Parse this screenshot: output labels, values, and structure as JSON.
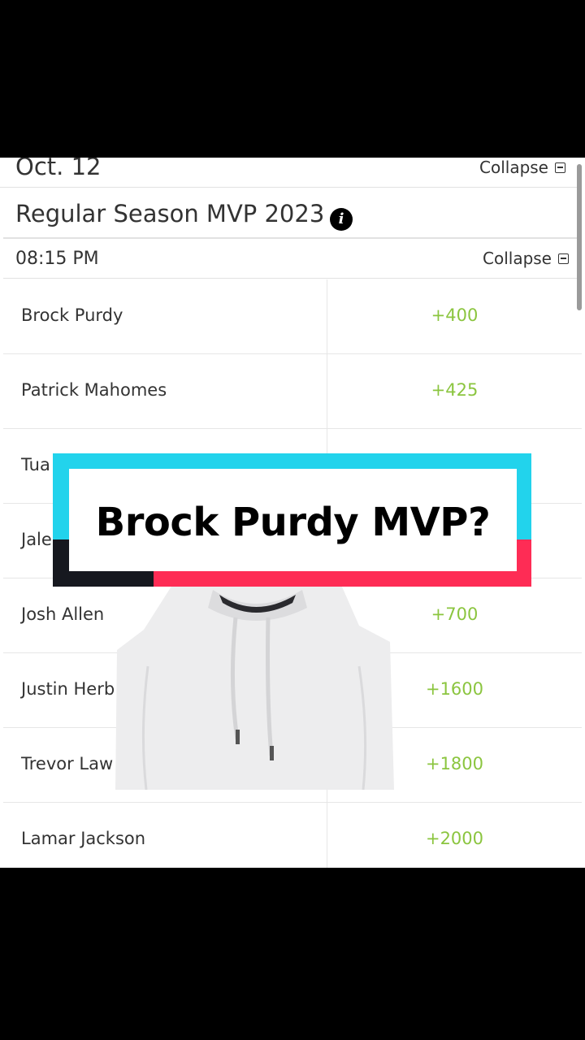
{
  "header": {
    "date": "Oct. 12",
    "collapse_label": "Collapse"
  },
  "market": {
    "title": "Regular Season MVP 2023",
    "info_icon": "info-icon"
  },
  "event": {
    "time": "08:15 PM",
    "collapse_label": "Collapse"
  },
  "odds": [
    {
      "name": "Brock Purdy",
      "price": "+400"
    },
    {
      "name": "Patrick Mahomes",
      "price": "+425"
    },
    {
      "name": "Tua",
      "price": ""
    },
    {
      "name": "Jale",
      "price": ""
    },
    {
      "name": "Josh Allen",
      "price": "+700"
    },
    {
      "name": "Justin Herb",
      "price": "+1600"
    },
    {
      "name": "Trevor Law",
      "price": "+1800"
    },
    {
      "name": "Lamar Jackson",
      "price": "+2000"
    }
  ],
  "overlay": {
    "caption": "Brock Purdy MVP?"
  },
  "colors": {
    "odds_green": "#8bc53f",
    "banner_cyan": "#22d3ec",
    "banner_red": "#fe2c55"
  }
}
